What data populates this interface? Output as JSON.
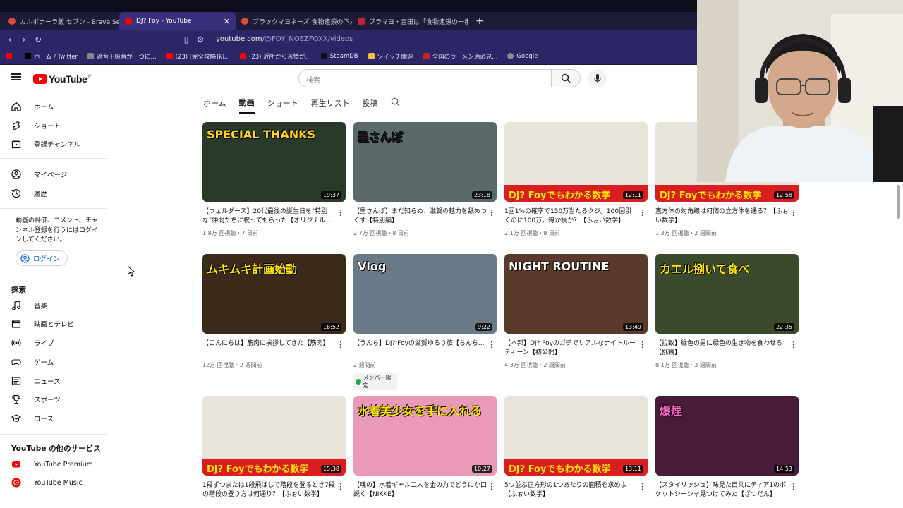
{
  "tabs": [
    {
      "label": "カルボナーラ飯 セブン - Brave Search",
      "color": "#e04a3a"
    },
    {
      "label": "DJ? Foy - YouTube",
      "color": "#ff0000"
    },
    {
      "label": "ブラックマヨネーズ 食物連鎖の下人 - B",
      "color": "#e04a3a"
    },
    {
      "label": "ブラマヨ・吉田は「食物連鎖の一番下の人",
      "color": "#c0232f"
    }
  ],
  "address": {
    "domain": "youtube.com",
    "path": "/@FOY_NOEZFOXX/videos"
  },
  "bookmarks": [
    {
      "label": "ホーム / Twitter",
      "color": "#000000"
    },
    {
      "label": "遮音＋吸音が一つに...",
      "color": "#555555"
    },
    {
      "label": "(23) [完全攻略]初...",
      "color": "#ff0000"
    },
    {
      "label": "(23) 近所から苦情が...",
      "color": "#ff0000"
    },
    {
      "label": "SteamDB",
      "color": "#111111"
    },
    {
      "label": "ツイッチ関連",
      "color": "#f0c040"
    },
    {
      "label": "全国のラーメン通必見...",
      "color": "#cc2222"
    },
    {
      "label": "Google",
      "color": "#4285f4"
    }
  ],
  "header": {
    "logo": "YouTube",
    "logo_region": "JP",
    "search_placeholder": "検索"
  },
  "sidebar": {
    "main": [
      "ホーム",
      "ショート",
      "登録チャンネル"
    ],
    "you": [
      "マイページ",
      "履歴"
    ],
    "note": "動画の評価、コメント、チャンネル登録を行うにはログインしてください。",
    "login": "ログイン",
    "explore_title": "探索",
    "explore": [
      "音楽",
      "映画とテレビ",
      "ライブ",
      "ゲーム",
      "ニュース",
      "スポーツ",
      "コース"
    ],
    "more_title": "YouTube の他のサービス",
    "more": [
      "YouTube Premium",
      "YouTube Music"
    ]
  },
  "channel_tabs": [
    "ホーム",
    "動画",
    "ショート",
    "再生リスト",
    "投稿"
  ],
  "videos": [
    {
      "title": "【ウェルダース】20代最後の誕生日を\"特別な\"仲間たちに祝ってもらった【オリジナル...",
      "meta": "1.8万 回視聴・7 日前",
      "duration": "19:37",
      "bg": "#2a3a2a",
      "overlay": "SPECIAL THANKS",
      "overlay_color": "#ffd21f"
    },
    {
      "title": "【墨さんぽ】まだ知らぬ、滋賀の魅力を舐めつくす【特別編】",
      "meta": "2.7万 回視聴・8 日前",
      "duration": "23:18",
      "bg": "#5a6a6a",
      "overlay": "墨さんぽ",
      "overlay_color": "#1d1d1d"
    },
    {
      "title": "1回1%の確率で150万当たるクジ。100回引くのに100万。得か損か？【ふぉい数学】",
      "meta": "2.1万 回視聴・9 日前",
      "duration": "12:11",
      "bg": "#e8e4dc",
      "overlay": "DJ? Foyでもわかる数学",
      "overlay_color": "#ffe600"
    },
    {
      "title": "直方体の対角線は何個の立方体を通る？【ふぉい数学】",
      "meta": "1.3万 回視聴・2 週間前",
      "duration": "12:58",
      "bg": "#e8e4dc",
      "overlay": "DJ? Foyでもわかる数学",
      "overlay_color": "#ffe600"
    },
    {
      "title": "【こんにちは】筋肉に挨拶してきた【筋肉】",
      "meta": "12万 回視聴・2 週間前",
      "duration": "16:52",
      "bg": "#3a2a1a",
      "overlay": "ムキムキ計画始動",
      "overlay_color": "#ffe600"
    },
    {
      "title": "【うんち】DJ? Foyの滋賀ゆるり旅【ちんち...",
      "meta": "2 週間前",
      "duration": "9:22",
      "bg": "#6a7a86",
      "overlay": "Vlog",
      "overlay_color": "#ffffff",
      "member": "メンバー限定"
    },
    {
      "title": "【本邦】DJ? Foyのガチでリアルなナイトルーティーン【初公開】",
      "meta": "4.3万 回視聴・2 週間前",
      "duration": "13:49",
      "bg": "#5a3a2a",
      "overlay": "NIGHT ROUTINE",
      "overlay_color": "#ffffff"
    },
    {
      "title": "【拉致】緑色の男に緑色の生き物を食わせる【挑戦】",
      "meta": "8.1万 回視聴・3 週間前",
      "duration": "22:35",
      "bg": "#3a4a2a",
      "overlay": "カエル捌いて食べ",
      "overlay_color": "#ffe600"
    },
    {
      "title": "1段ずつまたは1段飛ばしで階段を登るとき7段の階段の登り方は何通り？【ふぉい数学】",
      "meta": "",
      "duration": "15:38",
      "bg": "#e8e4dc",
      "overlay": "DJ? Foyでもわかる数学",
      "overlay_color": "#ffe600"
    },
    {
      "title": "【魂の】水着ギャル二人を金の力でどうにか口説く【NIKKE】",
      "meta": "",
      "duration": "10:27",
      "bg": "#e89ab8",
      "overlay": "水着美少女を手に入れる",
      "overlay_color": "#ffe600"
    },
    {
      "title": "5つ並ぶ正方形の1つあたりの面積を求めよ【ふぉい数学】",
      "meta": "",
      "duration": "13:11",
      "bg": "#e8e4dc",
      "overlay": "DJ? Foyでもわかる数学",
      "overlay_color": "#ffe600"
    },
    {
      "title": "【スタイリッシュ】味見た目共にティア1のポケットシーシャ見つけてみた【ざつだん】",
      "meta": "",
      "duration": "14:53",
      "bg": "#4a1a3a",
      "overlay": "爆煙",
      "overlay_color": "#ff66cc"
    }
  ]
}
